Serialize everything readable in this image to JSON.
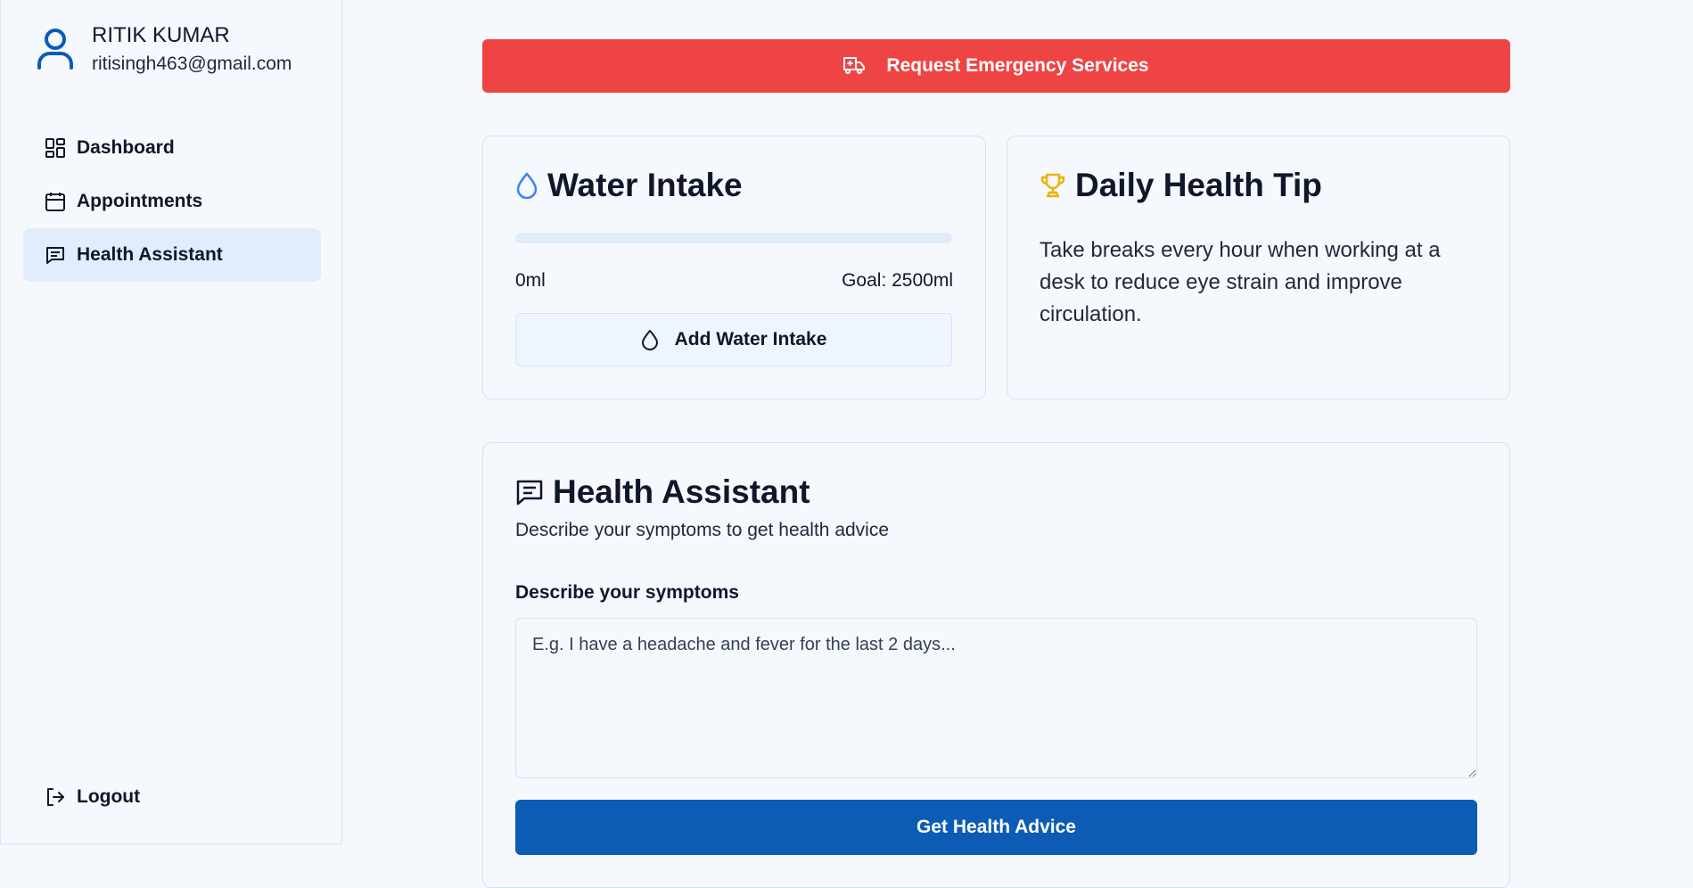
{
  "user": {
    "name": "RITIK KUMAR",
    "email": "ritisingh463@gmail.com"
  },
  "nav": {
    "items": [
      {
        "label": "Dashboard",
        "icon": "dashboard-icon"
      },
      {
        "label": "Appointments",
        "icon": "calendar-icon"
      },
      {
        "label": "Health Assistant",
        "icon": "message-icon",
        "active": true
      }
    ],
    "logout_label": "Logout"
  },
  "emergency": {
    "label": "Request Emergency Services",
    "icon": "ambulance-icon"
  },
  "water": {
    "title": "Water Intake",
    "current": "0ml",
    "goal": "Goal: 2500ml",
    "progress_percent": 0,
    "add_label": "Add Water Intake"
  },
  "tip": {
    "title": "Daily Health Tip",
    "text": "Take breaks every hour when working at a desk to reduce eye strain and improve circulation."
  },
  "assistant": {
    "title": "Health Assistant",
    "subtitle": "Describe your symptoms to get health advice",
    "field_label": "Describe your symptoms",
    "placeholder": "E.g. I have a headache and fever for the last 2 days...",
    "value": "",
    "button_label": "Get Health Advice"
  },
  "colors": {
    "emergency": "#ef4444",
    "primary": "#0c5cb6",
    "water_icon": "#3b82f6",
    "trophy_icon": "#eab308",
    "active_nav": "#e1edfc"
  }
}
